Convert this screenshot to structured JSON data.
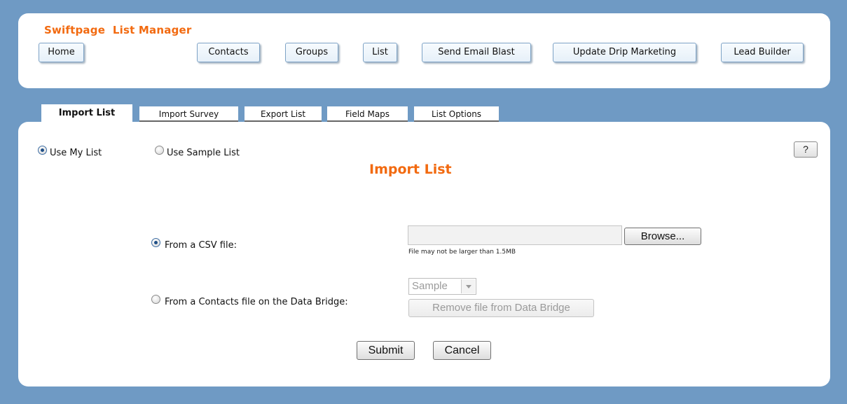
{
  "header": {
    "app_title": "Swiftpage  List Manager",
    "nav": [
      {
        "label": "Home"
      },
      {
        "label": "Contacts"
      },
      {
        "label": "Groups"
      },
      {
        "label": "List"
      },
      {
        "label": "Send Email Blast"
      },
      {
        "label": "Update Drip Marketing"
      },
      {
        "label": "Lead Builder"
      }
    ]
  },
  "tabs": [
    {
      "label": "Import List",
      "active": true
    },
    {
      "label": "Import Survey"
    },
    {
      "label": "Export List"
    },
    {
      "label": "Field Maps"
    },
    {
      "label": "List Options"
    }
  ],
  "list_source": {
    "use_my_list": "Use My List",
    "use_sample_list": "Use Sample List",
    "selected": "use_my_list"
  },
  "help_label": "?",
  "import": {
    "heading": "Import List",
    "csv_option_label": "From a CSV file:",
    "csv_selected": true,
    "browse_label": "Browse...",
    "file_value": "",
    "file_hint": "File may not be larger than 1.5MB",
    "bridge_option_label": "From a Contacts file on the Data Bridge:",
    "bridge_select_value": "Sample",
    "remove_label": "Remove file from Data Bridge"
  },
  "actions": {
    "submit_label": "Submit",
    "cancel_label": "Cancel"
  }
}
